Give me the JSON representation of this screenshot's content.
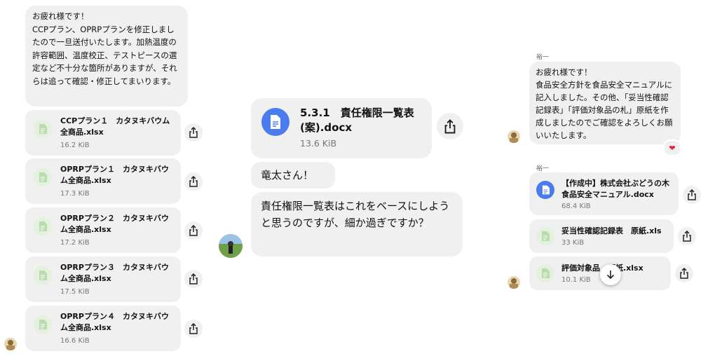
{
  "left": {
    "message": "お疲れ様です！\nCCPプラン、OPRPプランを修正しましたので一旦送付いたします。加熱温度の許容範囲、温度校正、テストピースの選定など不十分な箇所がありますが、それらは追って確認・修正してまいります。",
    "files": [
      {
        "name": "CCPプラン１　カタヌキバウム全商品.xlsx",
        "size": "16.2 KiB"
      },
      {
        "name": "OPRPプラン１　カタヌキバウム全商品.xlsx",
        "size": "17.3 KiB"
      },
      {
        "name": "OPRPプラン２　カタヌキバウム全商品.xlsx",
        "size": "17.2 KiB"
      },
      {
        "name": "OPRPプラン３　カタヌキバウム全商品.xlsx",
        "size": "17.5 KiB"
      },
      {
        "name": "OPRPプラン４　カタヌキバウム全商品.xlsx",
        "size": "16.6 KiB"
      }
    ]
  },
  "middle": {
    "file": {
      "name": "5.3.1　責任権限一覧表\n(案).docx",
      "size": "13.6 KiB"
    },
    "messages": [
      "竜太さん！",
      "責任権限一覧表はこれをベースにしようと思うのですが、細か過ぎですか？"
    ]
  },
  "right": {
    "sender1": "裕一",
    "message": "お疲れ様です！\n食品安全方針を食品安全マニュアルに記入しました。その他、「妥当性確認記録表」「評価対象品の札」原紙を作成しましたのでご確認をよろしくお願いいたします。",
    "reaction": "❤",
    "sender2": "裕一",
    "files": [
      {
        "name": "【作成中】株式会社ぶどうの木\n食品安全マニュアル.docx",
        "size": "68.4 KiB"
      },
      {
        "name": "妥当性確認記録表　原紙.xls",
        "size": "33 KiB"
      },
      {
        "name": "評価対象品　原紙.xlsx",
        "size": "10.1 KiB"
      }
    ]
  },
  "colors": {
    "bubble": "#f0f0f0",
    "doc_icon": "#4a7cf0",
    "xls_icon_bg": "#e3f1de",
    "heart": "#e0263f"
  }
}
